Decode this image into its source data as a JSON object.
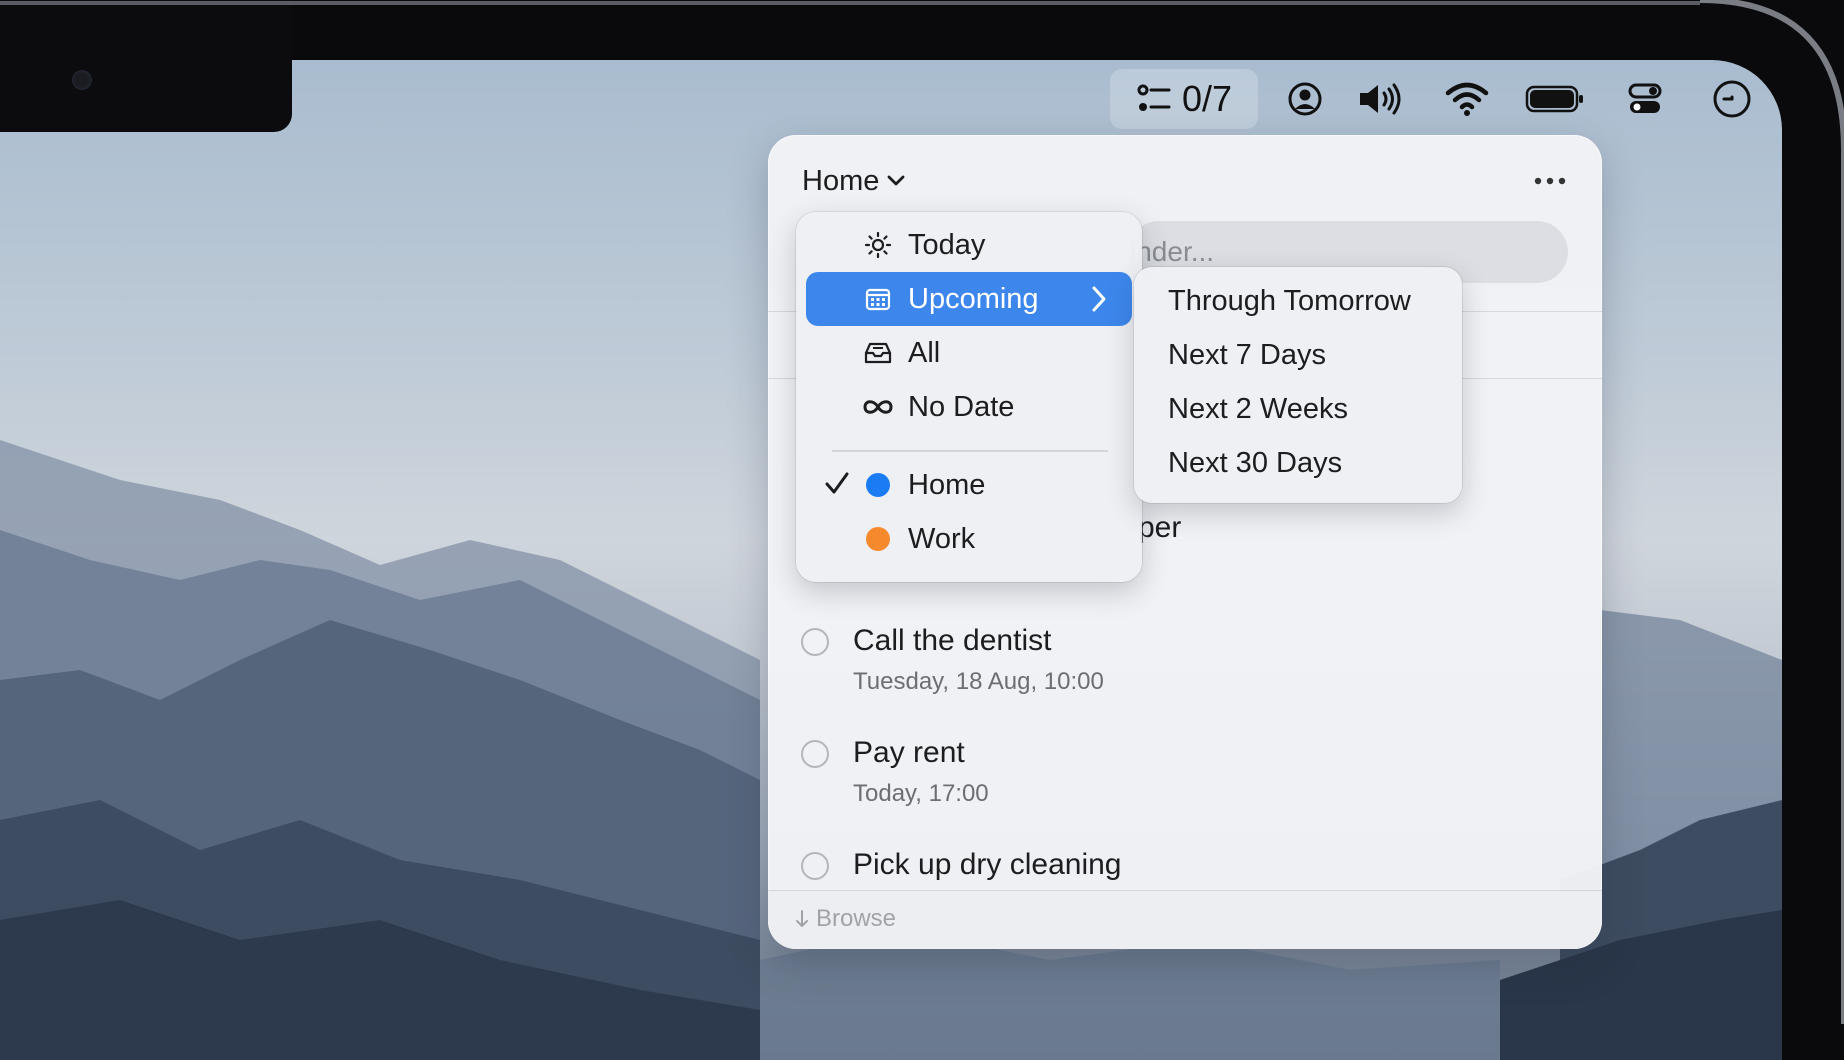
{
  "menubar": {
    "reminder_counter": "0/7",
    "icons": [
      "list-icon",
      "user-circle-icon",
      "speaker-icon",
      "wifi-icon",
      "battery-icon",
      "control-center-icon",
      "clock-icon"
    ]
  },
  "popover": {
    "list_selector_label": "Home",
    "search_placeholder_visible": "inder...",
    "partial_task_text": "per",
    "tasks": [
      {
        "title": "Call the dentist",
        "due": "Tuesday, 18 Aug, 10:00"
      },
      {
        "title": "Pay rent",
        "due": "Today, 17:00"
      },
      {
        "title": "Pick up dry cleaning",
        "due": ""
      }
    ],
    "footer": {
      "browse_label": "Browse"
    }
  },
  "menu": {
    "items": [
      {
        "label": "Today",
        "icon": "sun-icon"
      },
      {
        "label": "Upcoming",
        "icon": "calendar-icon",
        "active": true,
        "has_submenu": true
      },
      {
        "label": "All",
        "icon": "tray-icon"
      },
      {
        "label": "No Date",
        "icon": "infinity-icon"
      }
    ],
    "lists": [
      {
        "label": "Home",
        "color": "#1a7cf5",
        "checked": true
      },
      {
        "label": "Work",
        "color": "#f6892c",
        "checked": false
      }
    ]
  },
  "submenu": {
    "items": [
      "Through Tomorrow",
      "Next 7 Days",
      "Next 2 Weeks",
      "Next 30 Days"
    ]
  },
  "colors": {
    "accent": "#3d87ec",
    "home": "#1a7cf5",
    "work": "#f6892c"
  }
}
